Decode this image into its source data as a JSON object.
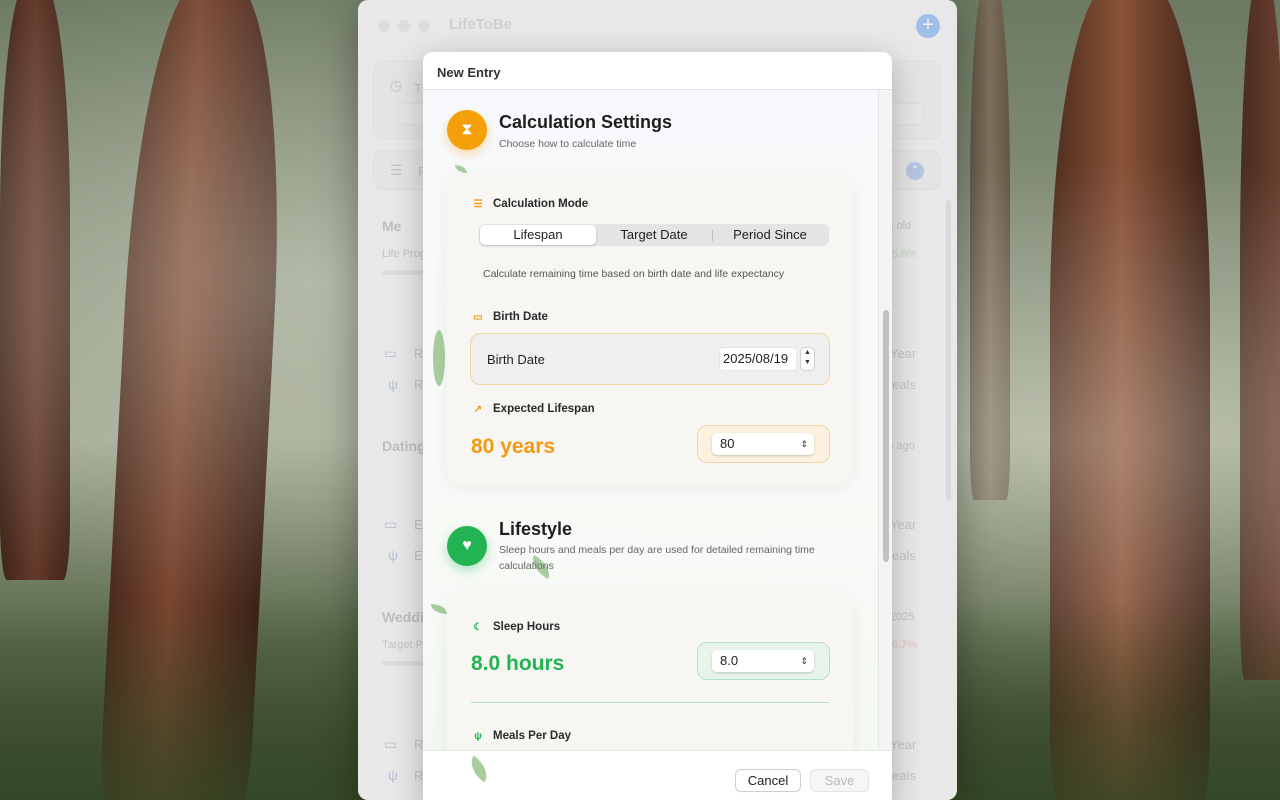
{
  "app": {
    "title": "LifeToBe",
    "add_button": "+"
  },
  "background_list": {
    "search_initial": "T",
    "filter_initial": "F",
    "entries": [
      {
        "name": "Me",
        "sub": "Life Prog",
        "right": "s old",
        "percent": "5.6%",
        "row1_letter": "R",
        "row1_right": "Year",
        "row2_letter": "R",
        "row2_right": "eals"
      },
      {
        "name": "Dating",
        "sub": "",
        "right": "s ago",
        "percent": "",
        "row1_letter": "E",
        "row1_right": "Year",
        "row2_letter": "E",
        "row2_right": "eals"
      },
      {
        "name": "Weddi",
        "sub": "Target P",
        "right": "2025",
        "percent": "6.7%",
        "row1_letter": "R",
        "row1_right": "Year",
        "row2_letter": "R",
        "row2_right": "eals"
      }
    ]
  },
  "sheet": {
    "title": "New Entry",
    "calc": {
      "icon": "hourglass-icon",
      "title": "Calculation Settings",
      "subtitle": "Choose how to calculate time",
      "mode_label": "Calculation Mode",
      "modes": [
        "Lifespan",
        "Target Date",
        "Period Since"
      ],
      "selected_mode": "Lifespan",
      "mode_hint": "Calculate remaining time based on birth date and life expectancy",
      "birth_section_label": "Birth Date",
      "birth_field_label": "Birth Date",
      "birth_value": "2025/08/19",
      "lifespan_label": "Expected Lifespan",
      "lifespan_display": "80 years",
      "lifespan_value": "80"
    },
    "lifestyle": {
      "icon": "heart-icon",
      "title": "Lifestyle",
      "subtitle": "Sleep hours and meals per day are used for detailed remaining time calculations",
      "sleep_label": "Sleep Hours",
      "sleep_display": "8.0 hours",
      "sleep_value": "8.0",
      "meals_label": "Meals Per Day"
    },
    "buttons": {
      "cancel": "Cancel",
      "save": "Save"
    }
  },
  "colors": {
    "accent_orange": "#f39a12",
    "accent_green": "#22b453",
    "accent_blue": "#4a8ef0"
  }
}
